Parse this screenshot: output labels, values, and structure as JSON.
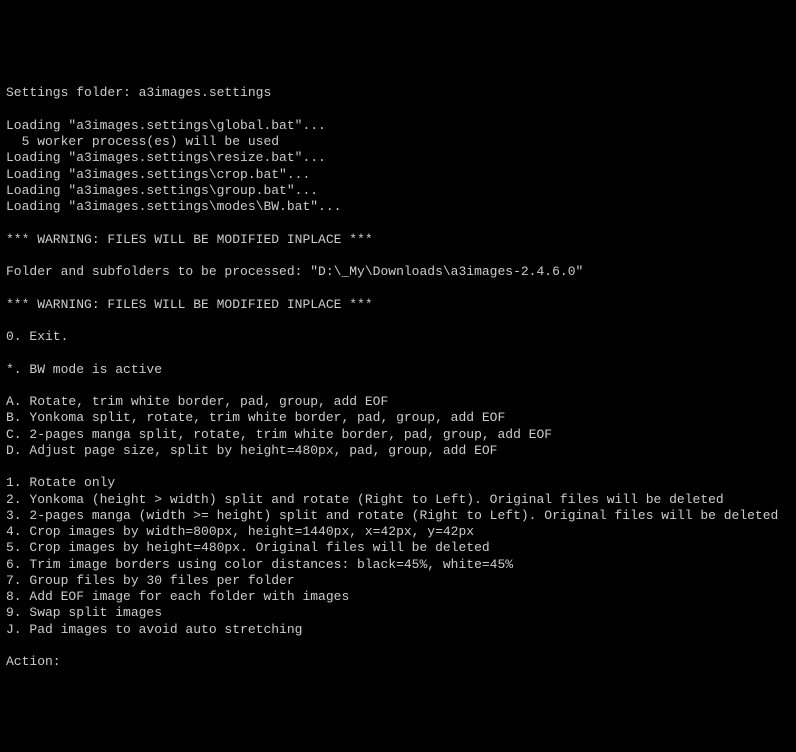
{
  "lines": {
    "settings_folder": "Settings folder: a3images.settings",
    "blank1": "",
    "load_global": "Loading \"a3images.settings\\global.bat\"...",
    "workers": "  5 worker process(es) will be used",
    "load_resize": "Loading \"a3images.settings\\resize.bat\"...",
    "load_crop": "Loading \"a3images.settings\\crop.bat\"...",
    "load_group": "Loading \"a3images.settings\\group.bat\"...",
    "load_bw": "Loading \"a3images.settings\\modes\\BW.bat\"...",
    "blank2": "",
    "warn1": "*** WARNING: FILES WILL BE MODIFIED INPLACE ***",
    "blank3": "",
    "folder_line": "Folder and subfolders to be processed: \"D:\\_My\\Downloads\\a3images-2.4.6.0\"",
    "blank4": "",
    "warn2": "*** WARNING: FILES WILL BE MODIFIED INPLACE ***",
    "blank5": "",
    "opt_0": "0. Exit.",
    "blank6": "",
    "opt_star": "*. BW mode is active",
    "blank7": "",
    "opt_A": "A. Rotate, trim white border, pad, group, add EOF",
    "opt_B": "B. Yonkoma split, rotate, trim white border, pad, group, add EOF",
    "opt_C": "C. 2-pages manga split, rotate, trim white border, pad, group, add EOF",
    "opt_D": "D. Adjust page size, split by height=480px, pad, group, add EOF",
    "blank8": "",
    "opt_1": "1. Rotate only",
    "opt_2": "2. Yonkoma (height > width) split and rotate (Right to Left). Original files will be deleted",
    "opt_3": "3. 2-pages manga (width >= height) split and rotate (Right to Left). Original files will be deleted",
    "opt_4": "4. Crop images by width=800px, height=1440px, x=42px, y=42px",
    "opt_5": "5. Crop images by height=480px. Original files will be deleted",
    "opt_6": "6. Trim image borders using color distances: black=45%, white=45%",
    "opt_7": "7. Group files by 30 files per folder",
    "opt_8": "8. Add EOF image for each folder with images",
    "opt_9": "9. Swap split images",
    "opt_J": "J. Pad images to avoid auto stretching",
    "blank9": "",
    "action_prompt": "Action:"
  }
}
